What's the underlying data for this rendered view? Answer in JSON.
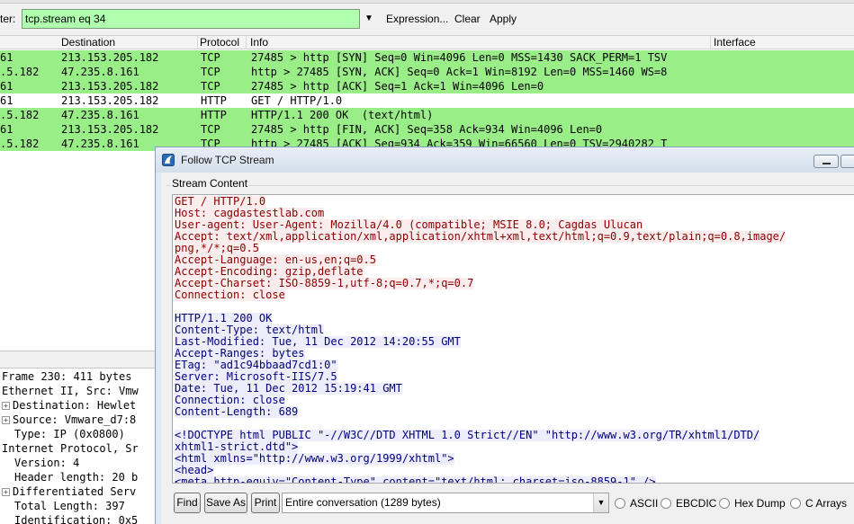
{
  "toolbar": {
    "filter_label": "ter:",
    "filter_value": "tcp.stream eq 34",
    "expression_label": "Expression...",
    "clear_label": "Clear",
    "apply_label": "Apply"
  },
  "packet_list": {
    "columns": [
      "Destination",
      "Protocol",
      "Info",
      "Interface"
    ],
    "rows": [
      {
        "src": "61",
        "dst": "213.153.205.182",
        "proto": "TCP",
        "info": "27485 > http [SYN] Seq=0 Win=4096 Len=0 MSS=1430 SACK_PERM=1 TSV"
      },
      {
        "src": ".5.182",
        "dst": "47.235.8.161",
        "proto": "TCP",
        "info": "http > 27485 [SYN, ACK] Seq=0 Ack=1 Win=8192 Len=0 MSS=1460 WS=8"
      },
      {
        "src": "61",
        "dst": "213.153.205.182",
        "proto": "TCP",
        "info": "27485 > http [ACK] Seq=1 Ack=1 Win=4096 Len=0"
      },
      {
        "src": "61",
        "dst": "213.153.205.182",
        "proto": "HTTP",
        "info": "GET / HTTP/1.0"
      },
      {
        "src": ".5.182",
        "dst": "47.235.8.161",
        "proto": "HTTP",
        "info": "HTTP/1.1 200 OK  (text/html)"
      },
      {
        "src": "61",
        "dst": "213.153.205.182",
        "proto": "TCP",
        "info": "27485 > http [FIN, ACK] Seq=358 Ack=934 Win=4096 Len=0"
      },
      {
        "src": ".5.182",
        "dst": "47.235.8.161",
        "proto": "TCP",
        "info": "http > 27485 [ACK] Seq=934 Ack=359 Win=66560 Len=0 TSV=2940282 T"
      }
    ]
  },
  "details": {
    "lines": [
      "Frame 230: 411 bytes",
      "Ethernet II, Src: Vmw",
      "Destination: Hewlet",
      "Source: Vmware_d7:8",
      "Type: IP (0x0800)",
      "Internet Protocol, Sr",
      "Version: 4",
      "Header length: 20 b",
      "Differentiated Serv",
      "Total Length: 397",
      "Identification: 0x5"
    ]
  },
  "dialog": {
    "title": "Follow TCP Stream",
    "group_label": "Stream Content",
    "stream_lines": [
      {
        "t": "c",
        "text": "GET / HTTP/1.0"
      },
      {
        "t": "c",
        "text": "Host: cagdastestlab.com"
      },
      {
        "t": "c",
        "text": "User-agent: User-Agent: Mozilla/4.0 (compatible; MSIE 8.0; Cagdas Ulucan"
      },
      {
        "t": "c",
        "text": "Accept: text/xml,application/xml,application/xhtml+xml,text/html;q=0.9,text/plain;q=0.8,image/"
      },
      {
        "t": "c",
        "text": "png,*/*;q=0.5"
      },
      {
        "t": "c",
        "text": "Accept-Language: en-us,en;q=0.5"
      },
      {
        "t": "c",
        "text": "Accept-Encoding: gzip,deflate"
      },
      {
        "t": "c",
        "text": "Accept-Charset: ISO-8859-1,utf-8;q=0.7,*;q=0.7"
      },
      {
        "t": "c",
        "text": "Connection: close"
      },
      {
        "t": "b",
        "text": ""
      },
      {
        "t": "s",
        "text": "HTTP/1.1 200 OK"
      },
      {
        "t": "s",
        "text": "Content-Type: text/html"
      },
      {
        "t": "s",
        "text": "Last-Modified: Tue, 11 Dec 2012 14:20:55 GMT"
      },
      {
        "t": "s",
        "text": "Accept-Ranges: bytes"
      },
      {
        "t": "s",
        "text": "ETag: \"ad1c94bbaad7cd1:0\""
      },
      {
        "t": "s",
        "text": "Server: Microsoft-IIS/7.5"
      },
      {
        "t": "s",
        "text": "Date: Tue, 11 Dec 2012 15:19:41 GMT"
      },
      {
        "t": "s",
        "text": "Connection: close"
      },
      {
        "t": "s",
        "text": "Content-Length: 689"
      },
      {
        "t": "b",
        "text": ""
      },
      {
        "t": "s",
        "text": "<!DOCTYPE html PUBLIC \"-//W3C//DTD XHTML 1.0 Strict//EN\" \"http://www.w3.org/TR/xhtml1/DTD/"
      },
      {
        "t": "s",
        "text": "xhtml1-strict.dtd\">"
      },
      {
        "t": "s",
        "text": "<html xmlns=\"http://www.w3.org/1999/xhtml\">"
      },
      {
        "t": "s",
        "text": "<head>"
      },
      {
        "t": "s",
        "text": "<meta http-equiv=\"Content-Type\" content=\"text/html; charset=iso-8859-1\" />"
      }
    ],
    "find_label": "Find",
    "save_as_label": "Save As",
    "print_label": "Print",
    "conversation_value": "Entire conversation (1289 bytes)",
    "radio_labels": [
      "ASCII",
      "EBCDIC",
      "Hex Dump",
      "C Arrays"
    ]
  },
  "colors": {
    "filter_ok": "#afffaf",
    "tcp_row": "#99ee88",
    "client_text": "#8b0000",
    "server_text": "#00007a"
  }
}
